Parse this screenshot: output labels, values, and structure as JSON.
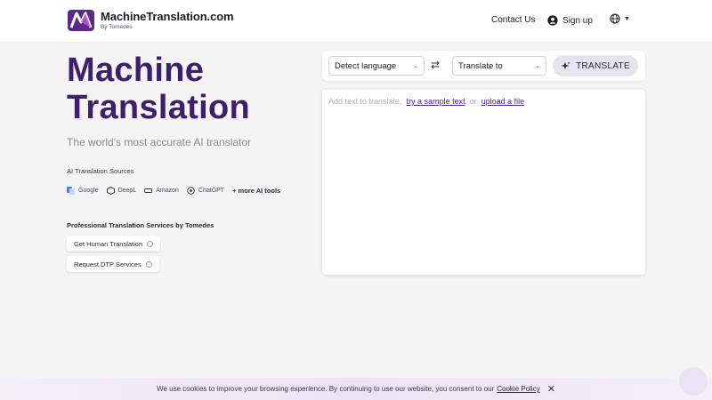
{
  "header": {
    "brand_name": "MachineTranslation.com",
    "brand_sub": "By Tomedes",
    "contact": "Contact Us",
    "signup": "Sign up"
  },
  "hero": {
    "title_line1": "Machine",
    "title_line2": "Translation",
    "subtitle": "The world's most accurate AI translator",
    "sources_label": "AI Translation Sources",
    "sources": [
      {
        "label": "Google",
        "icon": "google-translate-icon"
      },
      {
        "label": "DeepL",
        "icon": "deepl-icon"
      },
      {
        "label": "Amazon",
        "icon": "amazon-icon"
      },
      {
        "label": "ChatGPT",
        "icon": "chatgpt-icon"
      }
    ],
    "more_tools": "+ more AI tools",
    "pro_label": "Professional Translation Services by Tomedes",
    "pro_buttons": [
      "Get Human Translation",
      "Request DTP Services"
    ]
  },
  "translator": {
    "source_lang": "Detect language",
    "target_lang": "Translate to",
    "translate_button": "TRANSLATE",
    "prompt_text": "Add text to translate,",
    "sample_link": "try a sample text",
    "or_text": ", or",
    "upload_link": "upload a file"
  },
  "cookie": {
    "text": "We use cookies to improve your browsing experience. By continuing to use our website, you consent to our",
    "policy_link": "Cookie Policy"
  },
  "colors": {
    "brand_purple": "#3d1f6b",
    "accent": "#4b2c86",
    "page_bg": "#f4f4f5"
  }
}
